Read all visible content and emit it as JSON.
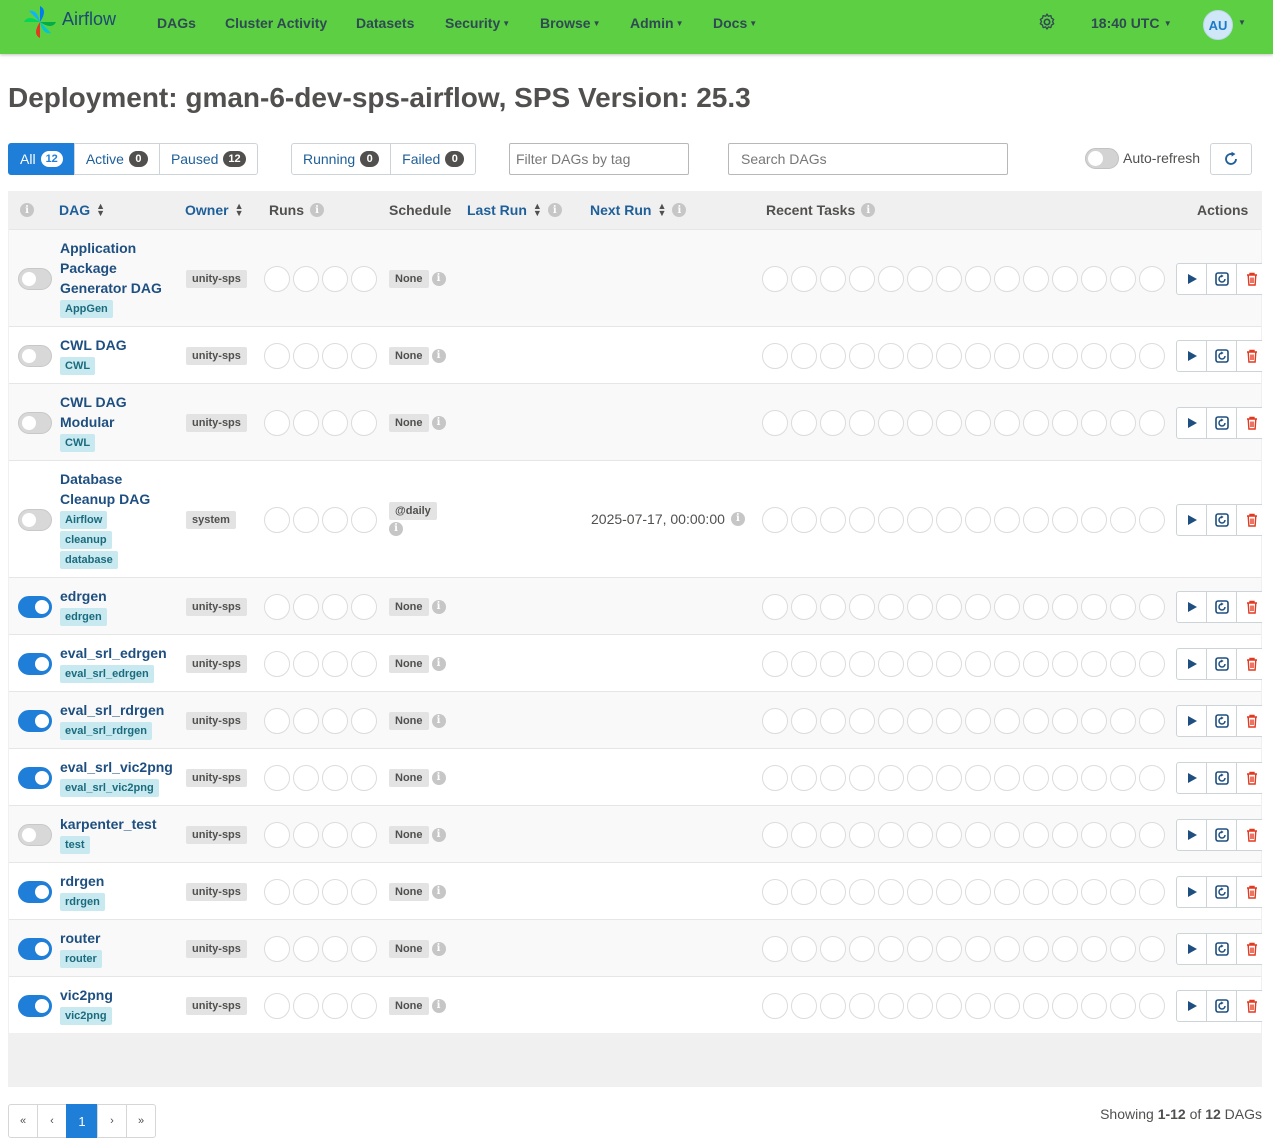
{
  "app": {
    "name": "Airflow"
  },
  "nav": {
    "items": [
      {
        "label": "DAGs",
        "caret": false
      },
      {
        "label": "Cluster Activity",
        "caret": false
      },
      {
        "label": "Datasets",
        "caret": false
      },
      {
        "label": "Security",
        "caret": true
      },
      {
        "label": "Browse",
        "caret": true
      },
      {
        "label": "Admin",
        "caret": true
      },
      {
        "label": "Docs",
        "caret": true
      }
    ],
    "time": "18:40 UTC",
    "user_initials": "AU"
  },
  "page_title": "Deployment: gman-6-dev-sps-airflow, SPS Version: 25.3",
  "status_filters": [
    {
      "label": "All",
      "count": "12",
      "active": true
    },
    {
      "label": "Active",
      "count": "0",
      "active": false
    },
    {
      "label": "Paused",
      "count": "12",
      "active": false
    }
  ],
  "run_filters": [
    {
      "label": "Running",
      "count": "0"
    },
    {
      "label": "Failed",
      "count": "0"
    }
  ],
  "tag_filter": {
    "placeholder": "Filter DAGs by tag"
  },
  "search": {
    "placeholder": "Search DAGs"
  },
  "auto_refresh": {
    "label": "Auto-refresh",
    "on": false
  },
  "columns": {
    "dag": "DAG",
    "owner": "Owner",
    "runs": "Runs",
    "schedule": "Schedule",
    "last_run": "Last Run",
    "next_run": "Next Run",
    "recent_tasks": "Recent Tasks",
    "actions": "Actions"
  },
  "dags": [
    {
      "name_lines": [
        "Application",
        "Package",
        "Generator DAG"
      ],
      "tags": [
        "AppGen"
      ],
      "owner": "unity-sps",
      "schedule": "None",
      "next_run": "",
      "active": false
    },
    {
      "name_lines": [
        "CWL DAG"
      ],
      "tags": [
        "CWL"
      ],
      "owner": "unity-sps",
      "schedule": "None",
      "next_run": "",
      "active": false
    },
    {
      "name_lines": [
        "CWL DAG",
        "Modular"
      ],
      "tags": [
        "CWL"
      ],
      "owner": "unity-sps",
      "schedule": "None",
      "next_run": "",
      "active": false
    },
    {
      "name_lines": [
        "Database",
        "Cleanup DAG"
      ],
      "tags": [
        "Airflow",
        "cleanup",
        "database"
      ],
      "owner": "system",
      "schedule": "@daily",
      "next_run": "2025-07-17, 00:00:00",
      "active": false
    },
    {
      "name_lines": [
        "edrgen"
      ],
      "tags": [
        "edrgen"
      ],
      "owner": "unity-sps",
      "schedule": "None",
      "next_run": "",
      "active": true
    },
    {
      "name_lines": [
        "eval_srl_edrgen"
      ],
      "tags": [
        "eval_srl_edrgen"
      ],
      "owner": "unity-sps",
      "schedule": "None",
      "next_run": "",
      "active": true
    },
    {
      "name_lines": [
        "eval_srl_rdrgen"
      ],
      "tags": [
        "eval_srl_rdrgen"
      ],
      "owner": "unity-sps",
      "schedule": "None",
      "next_run": "",
      "active": true
    },
    {
      "name_lines": [
        "eval_srl_vic2png"
      ],
      "tags": [
        "eval_srl_vic2png"
      ],
      "owner": "unity-sps",
      "schedule": "None",
      "next_run": "",
      "active": true
    },
    {
      "name_lines": [
        "karpenter_test"
      ],
      "tags": [
        "test"
      ],
      "owner": "unity-sps",
      "schedule": "None",
      "next_run": "",
      "active": false
    },
    {
      "name_lines": [
        "rdrgen"
      ],
      "tags": [
        "rdrgen"
      ],
      "owner": "unity-sps",
      "schedule": "None",
      "next_run": "",
      "active": true
    },
    {
      "name_lines": [
        "router"
      ],
      "tags": [
        "router"
      ],
      "owner": "unity-sps",
      "schedule": "None",
      "next_run": "",
      "active": true
    },
    {
      "name_lines": [
        "vic2png"
      ],
      "tags": [
        "vic2png"
      ],
      "owner": "unity-sps",
      "schedule": "None",
      "next_run": "",
      "active": true
    }
  ],
  "pagination": {
    "first": "«",
    "prev": "‹",
    "current": "1",
    "next": "›",
    "last": "»"
  },
  "showing": {
    "prefix": "Showing ",
    "range": "1-12",
    "middle": " of ",
    "total": "12",
    "suffix": " DAGs"
  },
  "colors": {
    "navbar": "#5ccf43",
    "accent": "#1e7ed8",
    "danger": "#e43921",
    "tag_bg": "#c7e9ef"
  }
}
